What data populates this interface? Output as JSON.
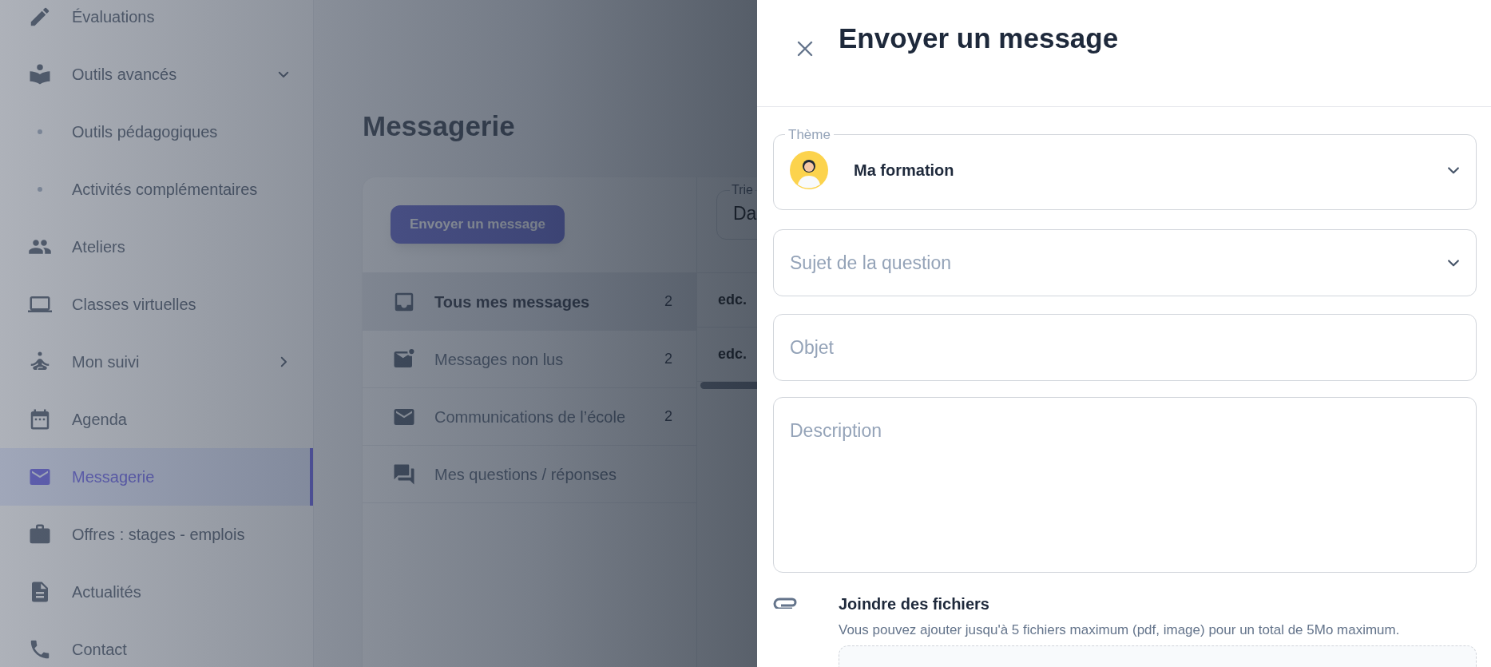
{
  "sidebar": {
    "items": [
      {
        "label": "Évaluations",
        "selected": false
      },
      {
        "label": "Outils avancés",
        "selected": false,
        "expanded": true,
        "children": [
          {
            "label": "Outils pédagogiques",
            "selected": false
          },
          {
            "label": "Activités complémentaires",
            "selected": false
          }
        ]
      },
      {
        "label": "Ateliers",
        "selected": false
      },
      {
        "label": "Classes virtuelles",
        "selected": false
      },
      {
        "label": "Mon suivi",
        "selected": false,
        "expanded": false
      },
      {
        "label": "Agenda",
        "selected": false
      },
      {
        "label": "Messagerie",
        "selected": true
      },
      {
        "label": "Offres : stages - emplois",
        "selected": false
      },
      {
        "label": "Actualités",
        "selected": false
      },
      {
        "label": "Contact",
        "selected": false
      }
    ]
  },
  "main": {
    "title": "Messagerie",
    "send_button": "Envoyer un message",
    "sort_field": {
      "label": "Trie",
      "value": "Da"
    },
    "folders": [
      {
        "label": "Tous mes messages",
        "count": "2",
        "selected": true
      },
      {
        "label": "Messages non lus",
        "count": "2",
        "selected": false
      },
      {
        "label": "Communications de l’école",
        "count": "2",
        "selected": false
      },
      {
        "label": "Mes questions / réponses",
        "selected": false
      }
    ],
    "messages": [
      {
        "sender": "edc."
      },
      {
        "sender": "edc."
      }
    ]
  },
  "panel": {
    "title": "Envoyer un message",
    "theme": {
      "label": "Thème",
      "value": "Ma formation"
    },
    "subject": {
      "placeholder": "Sujet de la question"
    },
    "object": {
      "placeholder": "Objet"
    },
    "description": {
      "placeholder": "Description"
    },
    "attachments": {
      "title": "Joindre des fichiers",
      "hint": "Vous pouvez ajouter jusqu'à 5 fichiers maximum (pdf, image) pour un total de 5Mo maximum."
    }
  }
}
